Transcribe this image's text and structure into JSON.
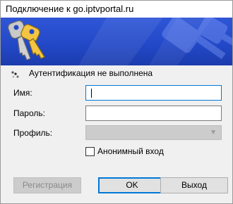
{
  "window": {
    "title": "Подключение к go.iptvportal.ru"
  },
  "status": {
    "text": "Аутентификация не выполнена",
    "icon": "spinner-icon"
  },
  "form": {
    "username": {
      "label": "Имя:",
      "value": ""
    },
    "password": {
      "label": "Пароль:",
      "value": ""
    },
    "profile": {
      "label": "Профиль:",
      "value": ""
    },
    "anonymous": {
      "label": "Анонимный вход",
      "checked": false
    }
  },
  "buttons": {
    "register": "Регистрация",
    "ok": "OK",
    "exit": "Выход"
  },
  "colors": {
    "banner": "#2349c8",
    "focus": "#0078d7"
  }
}
